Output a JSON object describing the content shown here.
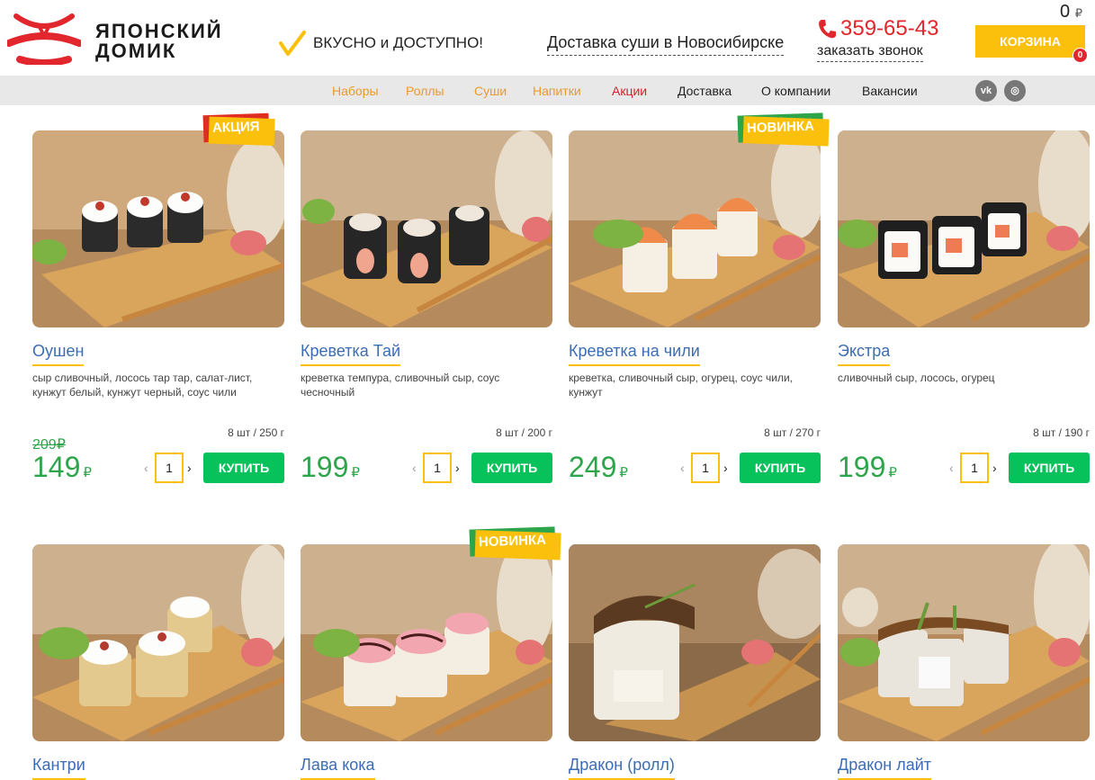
{
  "header": {
    "logo_text_line1": "ЯПОНСКИЙ",
    "logo_text_line2": "ДОМИК",
    "slogan": "ВКУСНО и ДОСТУПНО!",
    "delivery": "Доставка суши в Новосибирске",
    "phone": "359-65-43",
    "callback": "заказать звонок",
    "cart_total": "0",
    "currency": "₽",
    "cart_label": "КОРЗИНА",
    "cart_count": "0"
  },
  "nav": {
    "items": [
      {
        "label": "Наборы",
        "color": "orange"
      },
      {
        "label": "Роллы",
        "color": "orange"
      },
      {
        "label": "Суши",
        "color": "orange"
      },
      {
        "label": "Напитки",
        "color": "orange"
      },
      {
        "label": "Акции",
        "color": "red"
      },
      {
        "label": "Доставка",
        "color": "dark"
      },
      {
        "label": "О компании",
        "color": "dark"
      },
      {
        "label": "Вакансии",
        "color": "dark"
      }
    ],
    "social": [
      {
        "icon": "vk-icon",
        "glyph": "vk"
      },
      {
        "icon": "instagram-icon",
        "glyph": "◎"
      }
    ]
  },
  "products": [
    {
      "name": "Оушен",
      "desc": "сыр сливочный, лосось тар тар, салат-лист, кунжут белый, кунжут черный, соус чили",
      "weight": "8 шт / 250 г",
      "old_price": "209₽",
      "price": "149",
      "qty": "1",
      "badge": "АКЦИЯ",
      "badge_type": "sale"
    },
    {
      "name": "Креветка Тай",
      "desc": "креветка темпура, сливочный сыр, соус чесночный",
      "weight": "8 шт / 200 г",
      "old_price": "",
      "price": "199",
      "qty": "1",
      "badge": "",
      "badge_type": ""
    },
    {
      "name": "Креветка на чили",
      "desc": "креветка, сливочный сыр, огурец, соус чили, кунжут",
      "weight": "8 шт / 270 г",
      "old_price": "",
      "price": "249",
      "qty": "1",
      "badge": "НОВИНКА",
      "badge_type": "new"
    },
    {
      "name": "Экстра",
      "desc": "сливочный сыр, лосось, огурец",
      "weight": "8 шт / 190 г",
      "old_price": "",
      "price": "199",
      "qty": "1",
      "badge": "",
      "badge_type": ""
    },
    {
      "name": "Кантри",
      "badge": "",
      "badge_type": ""
    },
    {
      "name": "Лава кока",
      "badge": "НОВИНКА",
      "badge_type": "new"
    },
    {
      "name": "Дракон (ролл)",
      "badge": "",
      "badge_type": ""
    },
    {
      "name": "Дракон лайт",
      "badge": "",
      "badge_type": ""
    }
  ],
  "buy_label": "КУПИТЬ",
  "colors": {
    "accent_yellow": "#fbc00c",
    "brand_red": "#e1262d",
    "price_green": "#2fa54b",
    "buy_green": "#07c15b",
    "link_blue": "#3c6cb4"
  }
}
